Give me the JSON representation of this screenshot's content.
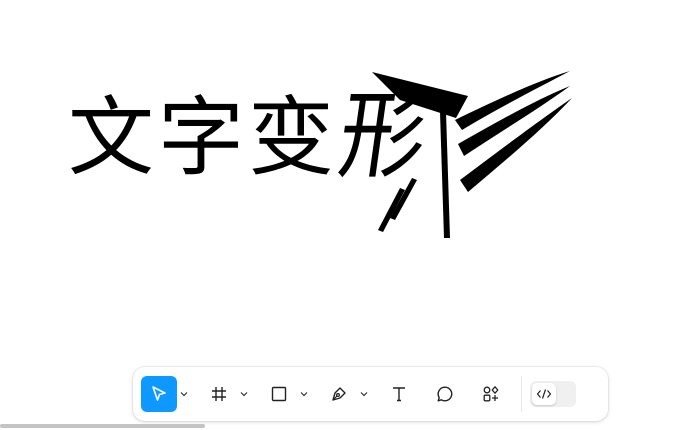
{
  "artwork": {
    "glyphs": [
      "文",
      "字",
      "变",
      "形"
    ],
    "text_color": "#000000"
  },
  "toolbar": {
    "accent_color": "#0d99ff",
    "tools": [
      {
        "name": "move-tool",
        "icon": "cursor-arrow-icon",
        "active": true,
        "has_menu": true
      },
      {
        "name": "frame-tool",
        "icon": "hash-frame-icon",
        "active": false,
        "has_menu": true
      },
      {
        "name": "shape-tool",
        "icon": "rectangle-icon",
        "active": false,
        "has_menu": true
      },
      {
        "name": "pen-tool",
        "icon": "pen-icon",
        "active": false,
        "has_menu": true
      },
      {
        "name": "text-tool",
        "icon": "text-t-icon",
        "active": false,
        "has_menu": false
      },
      {
        "name": "comment-tool",
        "icon": "speech-bubble-icon",
        "active": false,
        "has_menu": false
      },
      {
        "name": "resources-tool",
        "icon": "shapes-plus-icon",
        "active": false,
        "has_menu": false
      }
    ],
    "dev_mode": {
      "icon": "code-brackets-icon",
      "enabled": false
    }
  }
}
